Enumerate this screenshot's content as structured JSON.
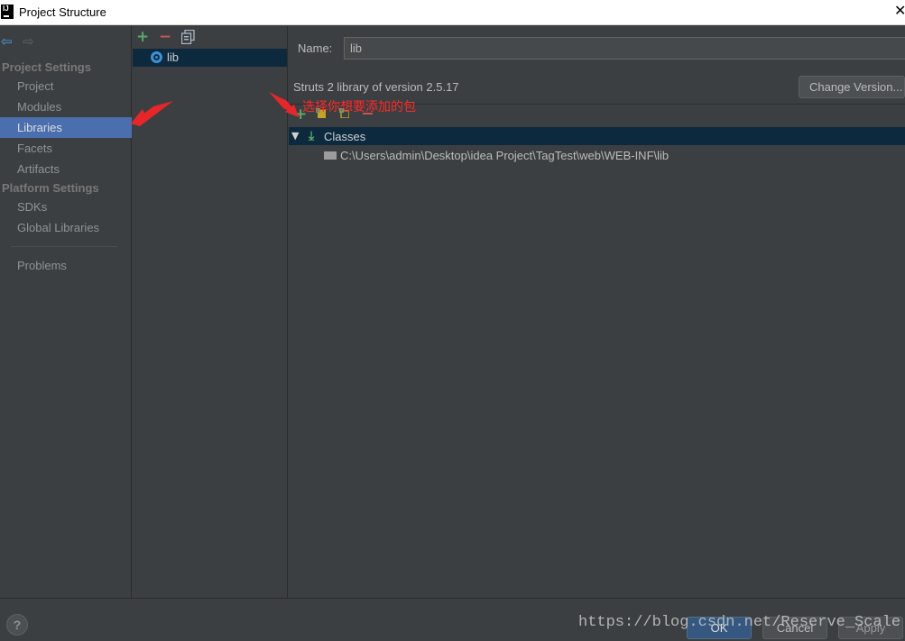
{
  "window": {
    "title": "Project Structure",
    "app_icon": "IJ",
    "close": "✕"
  },
  "nav": {
    "back_icon": "back-arrow-icon",
    "forward_icon": "forward-arrow-icon"
  },
  "sidebar": {
    "project_settings_title": "Project Settings",
    "project_items": [
      {
        "label": "Project",
        "selected": false
      },
      {
        "label": "Modules",
        "selected": false
      },
      {
        "label": "Libraries",
        "selected": true
      },
      {
        "label": "Facets",
        "selected": false
      },
      {
        "label": "Artifacts",
        "selected": false
      }
    ],
    "platform_settings_title": "Platform Settings",
    "platform_items": [
      {
        "label": "SDKs"
      },
      {
        "label": "Global Libraries"
      }
    ],
    "problems_label": "Problems"
  },
  "libraries": {
    "toolbar": {
      "add": "+",
      "remove": "−"
    },
    "items": [
      {
        "label": "lib",
        "selected": true
      }
    ]
  },
  "details": {
    "name_label": "Name:",
    "name_value": "lib",
    "description": "Struts 2 library of version 2.5.17",
    "change_version_label": "Change Version...",
    "annotation": "选择你想要添加的包",
    "tree": {
      "node_label": "Classes",
      "toggle": "▼",
      "path": "C:\\Users\\admin\\Desktop\\idea Project\\TagTest\\web\\WEB-INF\\lib"
    }
  },
  "footer": {
    "help": "?",
    "ok_label": "OK",
    "cancel_label": "Cancel",
    "apply_label": "Apply",
    "watermark": "https://blog.csdn.net/Reserve_Scale"
  },
  "colors": {
    "background": "#3c3f41",
    "selection_blue": "#4b6eaf",
    "tree_selection": "#0d293e",
    "add_green": "#59a869",
    "remove_red": "#c75450",
    "annotation_red": "#ff2a2a"
  }
}
